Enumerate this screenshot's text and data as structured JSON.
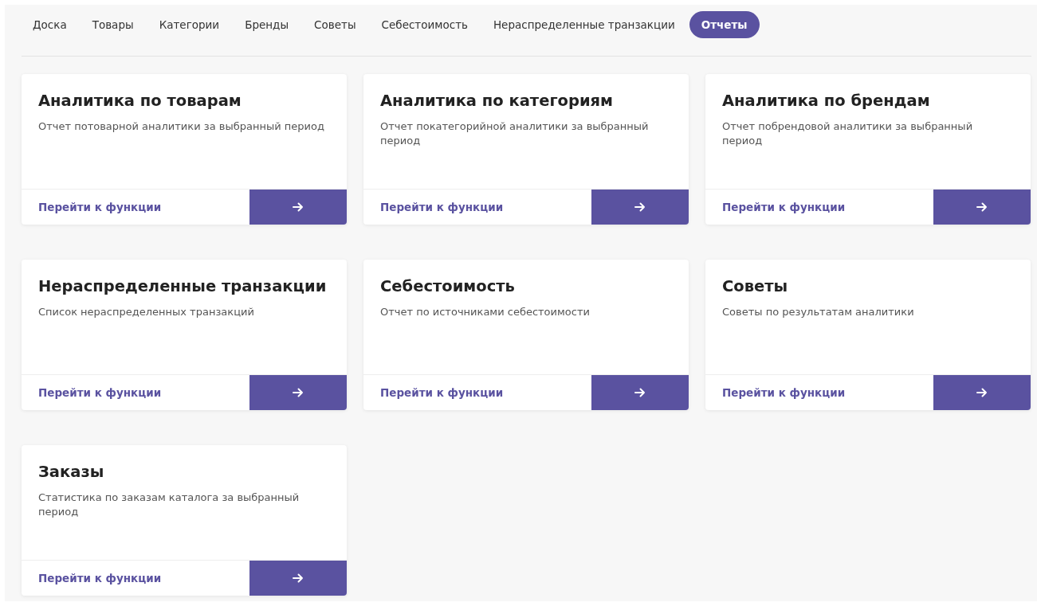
{
  "tabs": [
    {
      "label": "Доска",
      "selected": false
    },
    {
      "label": "Товары",
      "selected": false
    },
    {
      "label": "Категории",
      "selected": false
    },
    {
      "label": "Бренды",
      "selected": false
    },
    {
      "label": "Советы",
      "selected": false
    },
    {
      "label": "Себестоимость",
      "selected": false
    },
    {
      "label": "Нераспределенные транзакции",
      "selected": false
    },
    {
      "label": "Отчеты",
      "selected": true
    }
  ],
  "cards": [
    {
      "title": "Аналитика по товарам",
      "description": "Отчет потоварной аналитики за выбранный период",
      "link": "Перейти к функции"
    },
    {
      "title": "Аналитика по категориям",
      "description": "Отчет покатегорийной аналитики за выбранный период",
      "link": "Перейти к функции"
    },
    {
      "title": "Аналитика по брендам",
      "description": "Отчет побрендовой аналитики за выбранный период",
      "link": "Перейти к функции"
    },
    {
      "title": "Нераспределенные транзакции",
      "description": "Список нераспределенных транзакций",
      "link": "Перейти к функции"
    },
    {
      "title": "Себестоимость",
      "description": "Отчет по источниками себестоимости",
      "link": "Перейти к функции"
    },
    {
      "title": "Советы",
      "description": "Советы по результатам аналитики",
      "link": "Перейти к функции"
    },
    {
      "title": "Заказы",
      "description": "Статистика по заказам каталога за выбранный период",
      "link": "Перейти к функции"
    }
  ]
}
